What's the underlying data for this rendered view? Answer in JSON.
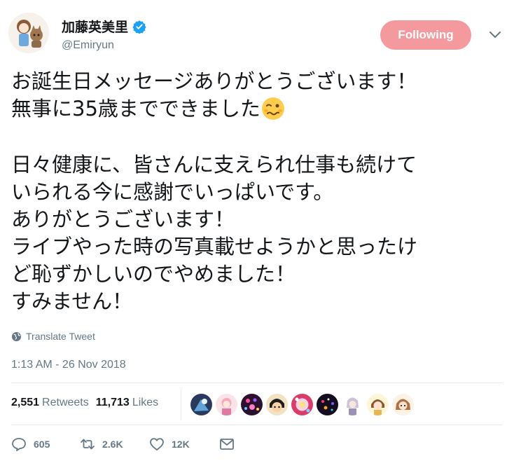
{
  "tweet": {
    "author": {
      "display_name": "加藤英美里",
      "handle": "@Emiryun",
      "verified": true
    },
    "follow_button": {
      "label": "Following",
      "color": "#f49a9f"
    },
    "text_lines": [
      "お誕生日メッセージありがとうございます！",
      "無事に35歳までできました",
      "",
      "日々健康に、皆さんに支えられ仕事も続けて",
      "いられる今に感謝でいっぱいです。",
      "ありがとうございます！",
      "ライブやった時の写真載せようかと思ったけ",
      "ど恥ずかしいのでやめました！",
      "すみません！"
    ],
    "inline_emoji": "woozy-face-icon",
    "translate_label": "Translate Tweet",
    "timestamp": "1:13 AM - 26 Nov 2018",
    "stats": {
      "retweets": {
        "count": "2,551",
        "label": "Retweets"
      },
      "likes": {
        "count": "11,713",
        "label": "Likes"
      }
    },
    "likers_count_shown": 9,
    "actions": {
      "reply_count": "605",
      "retweet_count": "2.6K",
      "like_count": "12K"
    },
    "colors": {
      "text": "#14171a",
      "muted": "#657786",
      "verified": "#1da1f2",
      "divider": "#e6ecf0"
    }
  }
}
